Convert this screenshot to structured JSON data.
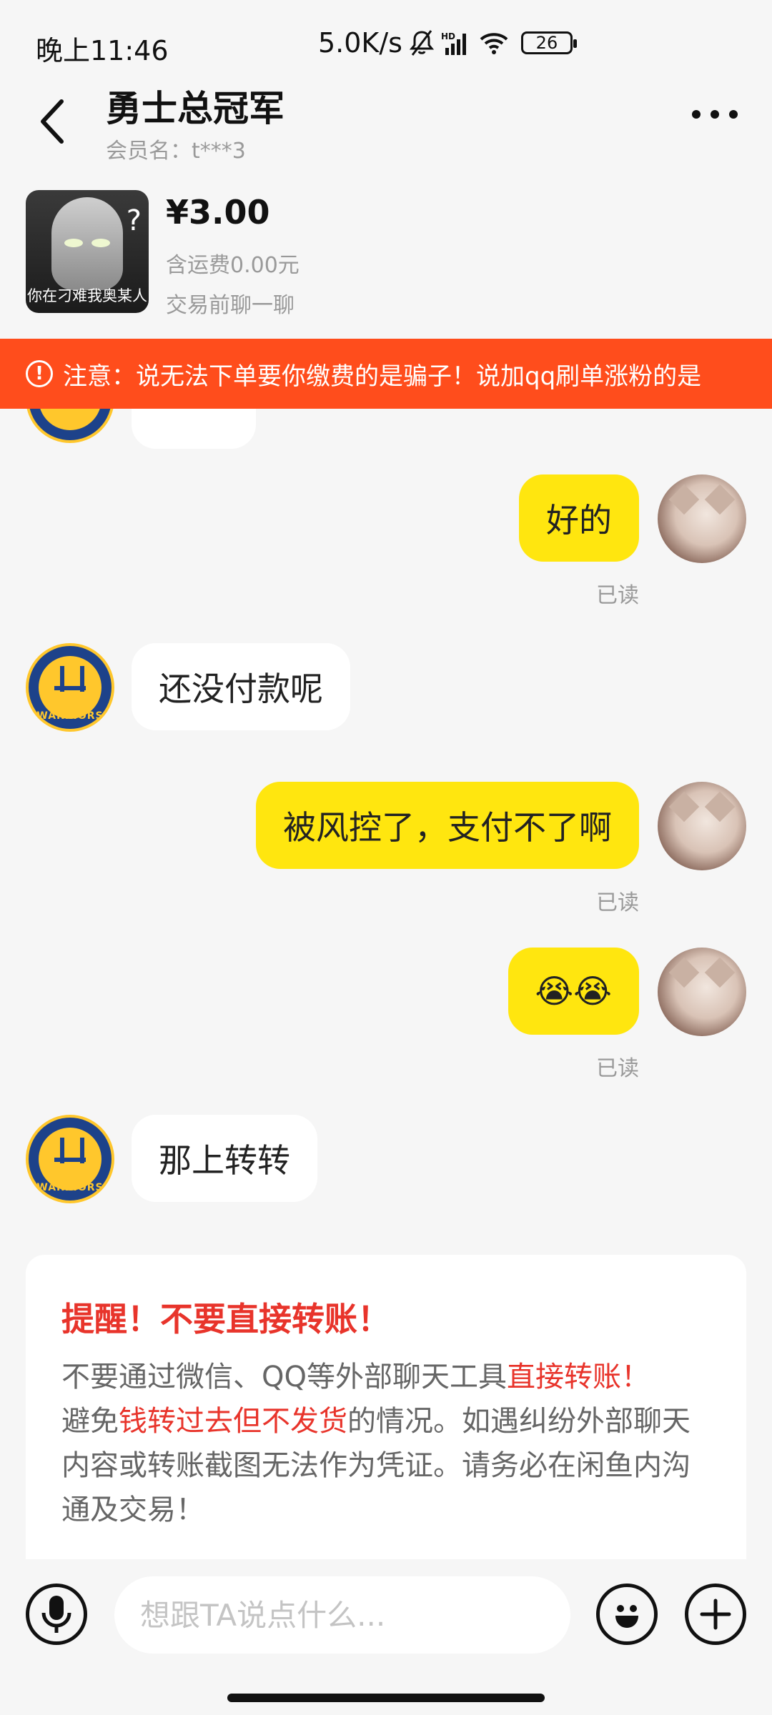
{
  "status_bar": {
    "time": "晚上11:46",
    "net_speed": "5.0K/s",
    "battery": "26"
  },
  "header": {
    "title": "勇士总冠军",
    "member": "会员名：t***3"
  },
  "product": {
    "thumb_caption": "你在刁难我奥某人",
    "thumb_mark": "?",
    "price": "¥3.00",
    "shipping": "含运费0.00元",
    "chat_hint": "交易前聊一聊"
  },
  "warning": {
    "text": "注意：说无法下单要你缴费的是骗子！说加qq刷单涨粉的是"
  },
  "messages": [
    {
      "side": "right",
      "text": "好的",
      "read": "已读"
    },
    {
      "side": "left",
      "text": "还没付款呢"
    },
    {
      "side": "right",
      "text": "被风控了，支付不了啊",
      "read": "已读"
    },
    {
      "side": "right",
      "text": "😭😭",
      "read": "已读"
    },
    {
      "side": "left",
      "text": "那上转转"
    }
  ],
  "avatar_team_text": "WARRIORS",
  "reminder": {
    "title": "提醒！不要直接转账！",
    "p1": "不要通过微信、QQ等外部聊天工具",
    "p1_red": "直接转账！",
    "p2": "避免",
    "p2_red": "钱转过去但不发货",
    "p3": "的情况。如遇纠纷外部聊天内容或转账截图无法作为凭证。请务必在闲鱼内沟通及交易！"
  },
  "input": {
    "placeholder": "想跟TA说点什么..."
  },
  "colors": {
    "warning_bg": "#ff4d1c",
    "bubble_mine": "#ffe60f",
    "reminder_red": "#e8342b"
  }
}
